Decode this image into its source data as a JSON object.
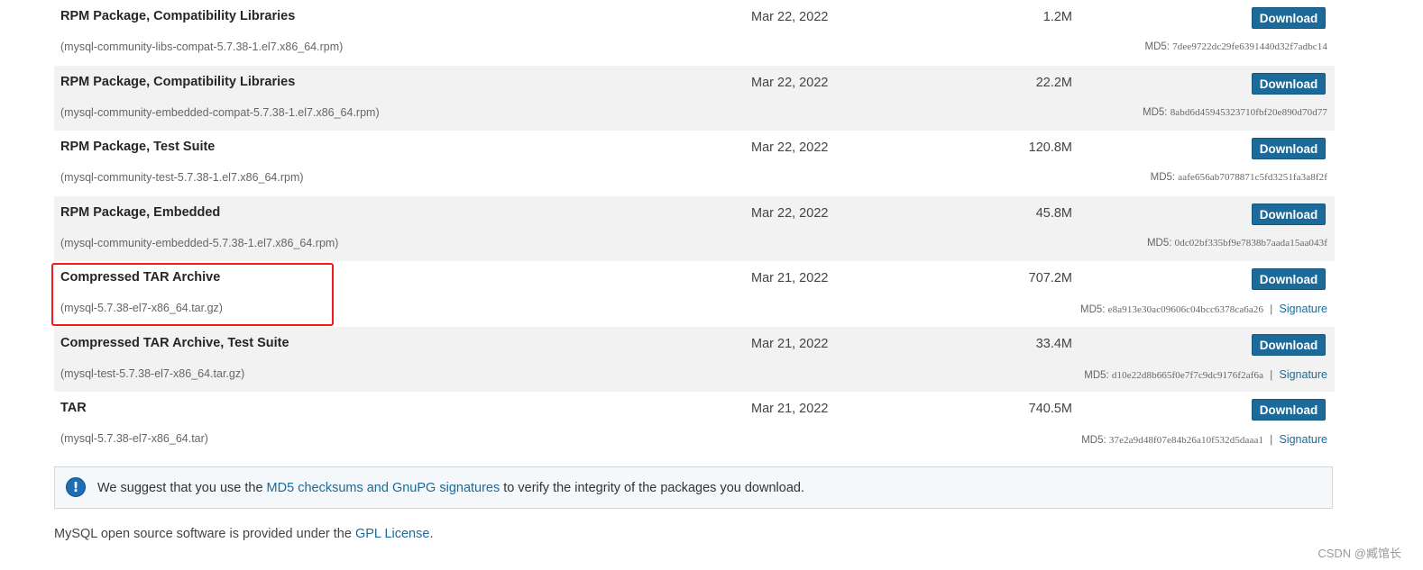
{
  "packages": [
    {
      "title": "RPM Package, Compatibility Libraries",
      "file": "(mysql-community-libs-compat-5.7.38-1.el7.x86_64.rpm)",
      "date": "Mar 22, 2022",
      "size": "1.2M",
      "download_label": "Download",
      "md5_label": "MD5:",
      "md5": "7dee9722dc29fe6391440d32f7adbc14",
      "signature_label": ""
    },
    {
      "title": "RPM Package, Compatibility Libraries",
      "file": "(mysql-community-embedded-compat-5.7.38-1.el7.x86_64.rpm)",
      "date": "Mar 22, 2022",
      "size": "22.2M",
      "download_label": "Download",
      "md5_label": "MD5:",
      "md5": "8abd6d45945323710fbf20e890d70d77",
      "signature_label": ""
    },
    {
      "title": "RPM Package, Test Suite",
      "file": "(mysql-community-test-5.7.38-1.el7.x86_64.rpm)",
      "date": "Mar 22, 2022",
      "size": "120.8M",
      "download_label": "Download",
      "md5_label": "MD5:",
      "md5": "aafe656ab7078871c5fd3251fa3a8f2f",
      "signature_label": ""
    },
    {
      "title": "RPM Package, Embedded",
      "file": "(mysql-community-embedded-5.7.38-1.el7.x86_64.rpm)",
      "date": "Mar 22, 2022",
      "size": "45.8M",
      "download_label": "Download",
      "md5_label": "MD5:",
      "md5": "0dc02bf335bf9e7838b7aada15aa043f",
      "signature_label": ""
    },
    {
      "title": "Compressed TAR Archive",
      "file": "(mysql-5.7.38-el7-x86_64.tar.gz)",
      "date": "Mar 21, 2022",
      "size": "707.2M",
      "download_label": "Download",
      "md5_label": "MD5:",
      "md5": "e8a913e30ac09606c04bcc6378ca6a26",
      "signature_label": "Signature"
    },
    {
      "title": "Compressed TAR Archive, Test Suite",
      "file": "(mysql-test-5.7.38-el7-x86_64.tar.gz)",
      "date": "Mar 21, 2022",
      "size": "33.4M",
      "download_label": "Download",
      "md5_label": "MD5:",
      "md5": "d10e22d8b665f0e7f7c9dc9176f2af6a",
      "signature_label": "Signature"
    },
    {
      "title": "TAR",
      "file": "(mysql-5.7.38-el7-x86_64.tar)",
      "date": "Mar 21, 2022",
      "size": "740.5M",
      "download_label": "Download",
      "md5_label": "MD5:",
      "md5": "37e2a9d48f07e84b26a10f532d5daaa1",
      "signature_label": "Signature"
    }
  ],
  "separator": "|",
  "notice": {
    "icon": "info-exclamation-icon",
    "prefix": "We suggest that you use the ",
    "link": "MD5 checksums and GnuPG signatures",
    "suffix": " to verify the integrity of the packages you download."
  },
  "license": {
    "prefix": "MySQL open source software is provided under the ",
    "link": "GPL License",
    "suffix": "."
  },
  "watermark": "CSDN @臧馆长",
  "colors": {
    "button": "#1c6a99",
    "link": "#1c6a99",
    "highlight": "#ee1c1c",
    "alt_row": "#f2f2f2"
  }
}
